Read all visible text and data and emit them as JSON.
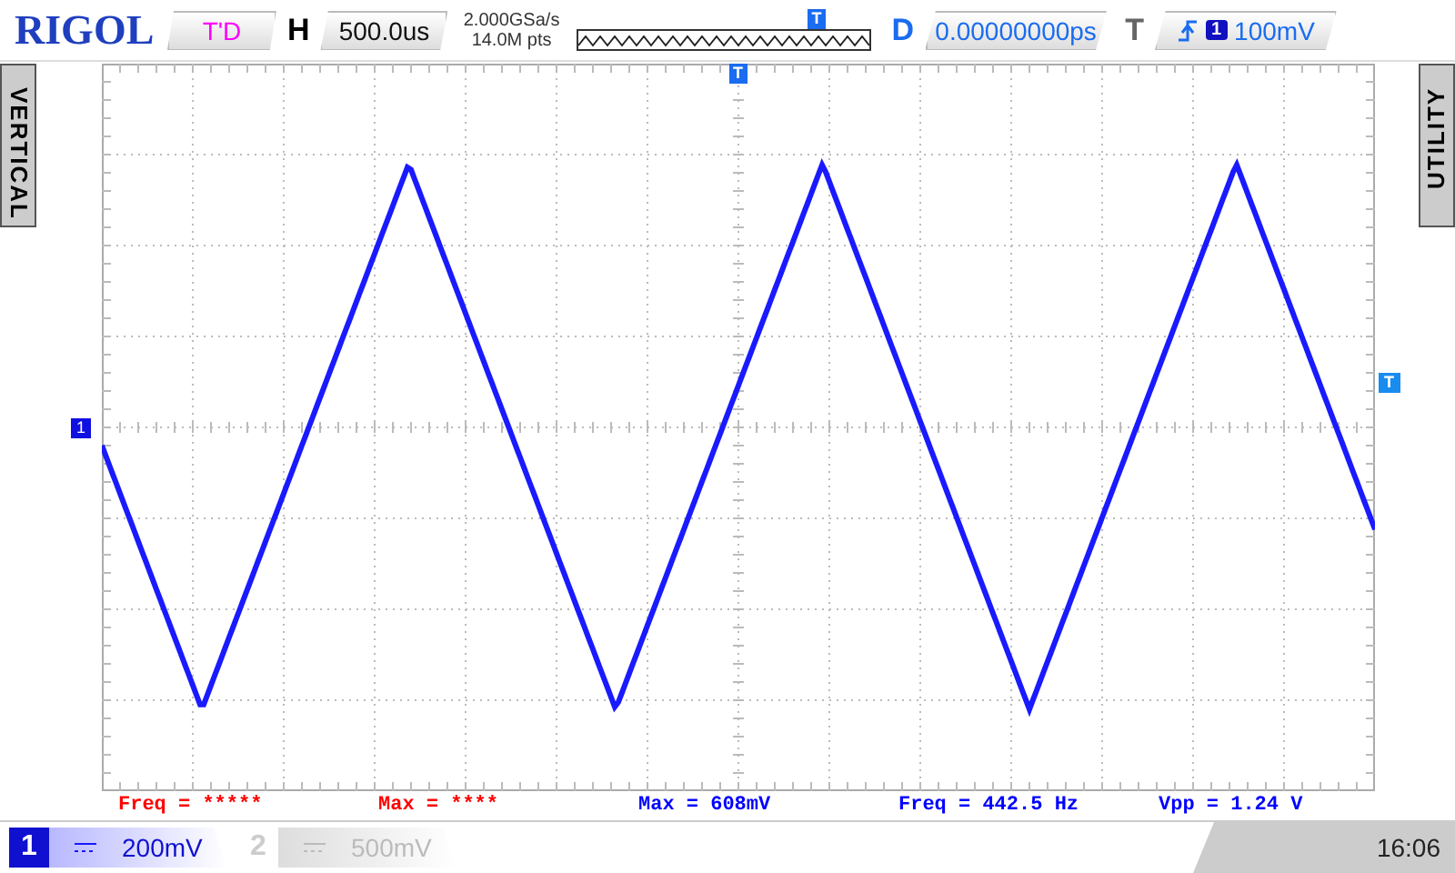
{
  "logo": "RIGOL",
  "run_status": "T'D",
  "horizontal": {
    "label": "H",
    "timebase": "500.0us",
    "sample_rate": "2.000GSa/s",
    "memory_depth": "14.0M pts",
    "position_marker": "T"
  },
  "delay": {
    "label": "D",
    "value": "0.00000000ps"
  },
  "trigger": {
    "label": "T",
    "channel": "1",
    "level": "100mV"
  },
  "side_tabs": {
    "left": "VERTICAL",
    "right": "UTILITY"
  },
  "screen_markers": {
    "trigger_position": "T",
    "channel": "1",
    "trigger_level": "T"
  },
  "measurements": [
    {
      "text": "Freq = *****",
      "color": "#ff0000"
    },
    {
      "text": "Max = ****",
      "color": "#ff0000"
    },
    {
      "text": "Max = 608mV",
      "color": "#0000ff"
    },
    {
      "text": "Freq = 442.5 Hz",
      "color": "#0000ff"
    },
    {
      "text": "Vpp = 1.24 V",
      "color": "#0000ff"
    }
  ],
  "channels": [
    {
      "number": "1",
      "scale": "200mV",
      "on": true
    },
    {
      "number": "2",
      "scale": "500mV",
      "on": false
    }
  ],
  "clock": "16:06"
}
